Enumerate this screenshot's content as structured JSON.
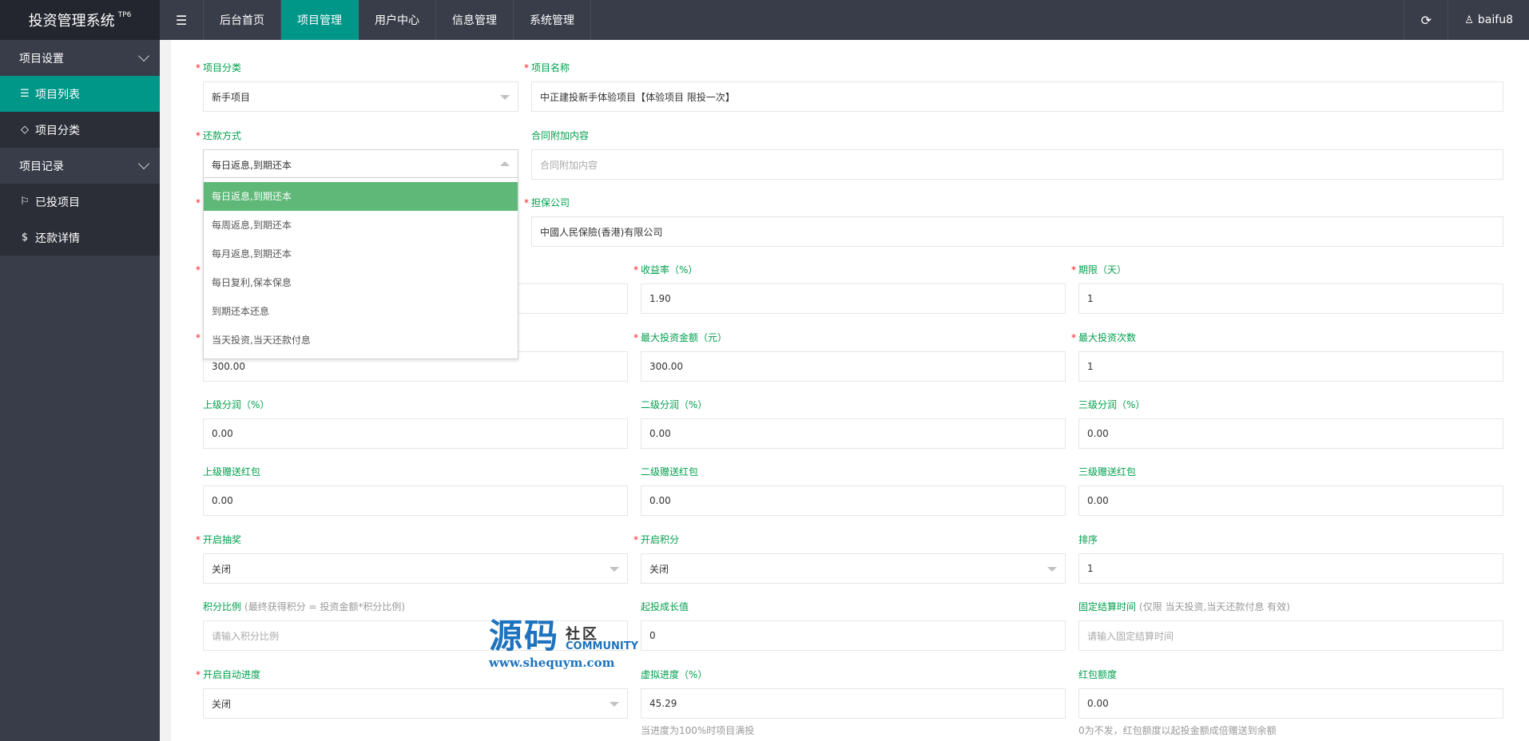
{
  "app": {
    "title": "投资管理系统",
    "title_sup": "TP6"
  },
  "nav": {
    "items": [
      {
        "label": "后台首页"
      },
      {
        "label": "项目管理"
      },
      {
        "label": "用户中心"
      },
      {
        "label": "信息管理"
      },
      {
        "label": "系统管理"
      }
    ],
    "active_index": 1
  },
  "header": {
    "user": "baifu8"
  },
  "sidebar": {
    "group1": "项目设置",
    "item_list": "项目列表",
    "item_category": "项目分类",
    "group2": "项目记录",
    "item_invested": "已投项目",
    "item_repay": "还款详情"
  },
  "form": {
    "category": {
      "label": "项目分类",
      "value": "新手项目"
    },
    "name": {
      "label": "项目名称",
      "value": "中正建投新手体验项目【体验项目 限投一次】"
    },
    "repay_method": {
      "label": "还款方式",
      "value": "每日返息,到期还本"
    },
    "contract_extra": {
      "label": "合同附加内容",
      "placeholder": "合同附加内容"
    },
    "guarantor": {
      "label": "担保公司",
      "value": "中國人民保險(香港)有限公司"
    },
    "rate": {
      "label": "收益率（%）",
      "value": "1.90"
    },
    "term": {
      "label": "期限（天）",
      "value": "1"
    },
    "min_amount": {
      "value": "300.00"
    },
    "max_amount": {
      "label": "最大投资金额（元）",
      "value": "300.00"
    },
    "max_times": {
      "label": "最大投资次数",
      "value": "1"
    },
    "lv1_share": {
      "label": "上级分润（%）",
      "value": "0.00"
    },
    "lv2_share": {
      "label": "二级分润（%）",
      "value": "0.00"
    },
    "lv3_share": {
      "label": "三级分润（%）",
      "value": "0.00"
    },
    "lv1_redpack": {
      "label": "上级赠送红包",
      "value": "0.00"
    },
    "lv2_redpack": {
      "label": "二级赠送红包",
      "value": "0.00"
    },
    "lv3_redpack": {
      "label": "三级赠送红包",
      "value": "0.00"
    },
    "lottery": {
      "label": "开启抽奖",
      "value": "关闭"
    },
    "points": {
      "label": "开启积分",
      "value": "关闭"
    },
    "sort": {
      "label": "排序",
      "value": "1"
    },
    "points_ratio": {
      "label": "积分比例",
      "hint": "(最终获得积分 = 投资金额*积分比例)",
      "placeholder": "请输入积分比例"
    },
    "growth": {
      "label": "起投成长值",
      "value": "0"
    },
    "settle_time": {
      "label": "固定结算时间",
      "hint": "(仅限 当天投资,当天还款付息 有效)",
      "placeholder": "请输入固定结算时间"
    },
    "auto_progress": {
      "label": "开启自动进度",
      "value": "关闭"
    },
    "virtual_progress": {
      "label": "虚拟进度（%）",
      "value": "45.29",
      "help": "当进度为100%时项目满投"
    },
    "redpack_amount": {
      "label": "红包额度",
      "value": "0.00",
      "help": "0为不发，红包额度以起投金额成倍赠送到余额"
    }
  },
  "dropdown": {
    "options": [
      "每日返息,到期还本",
      "每周返息,到期还本",
      "每月返息,到期还本",
      "每日复利,保本保息",
      "到期还本还息",
      "当天投资,当天还款付息"
    ],
    "selected_index": 0
  },
  "watermark": {
    "big": "源码",
    "cn": "社区",
    "en": "COMMUNITY",
    "url": "www.shequym.com"
  }
}
